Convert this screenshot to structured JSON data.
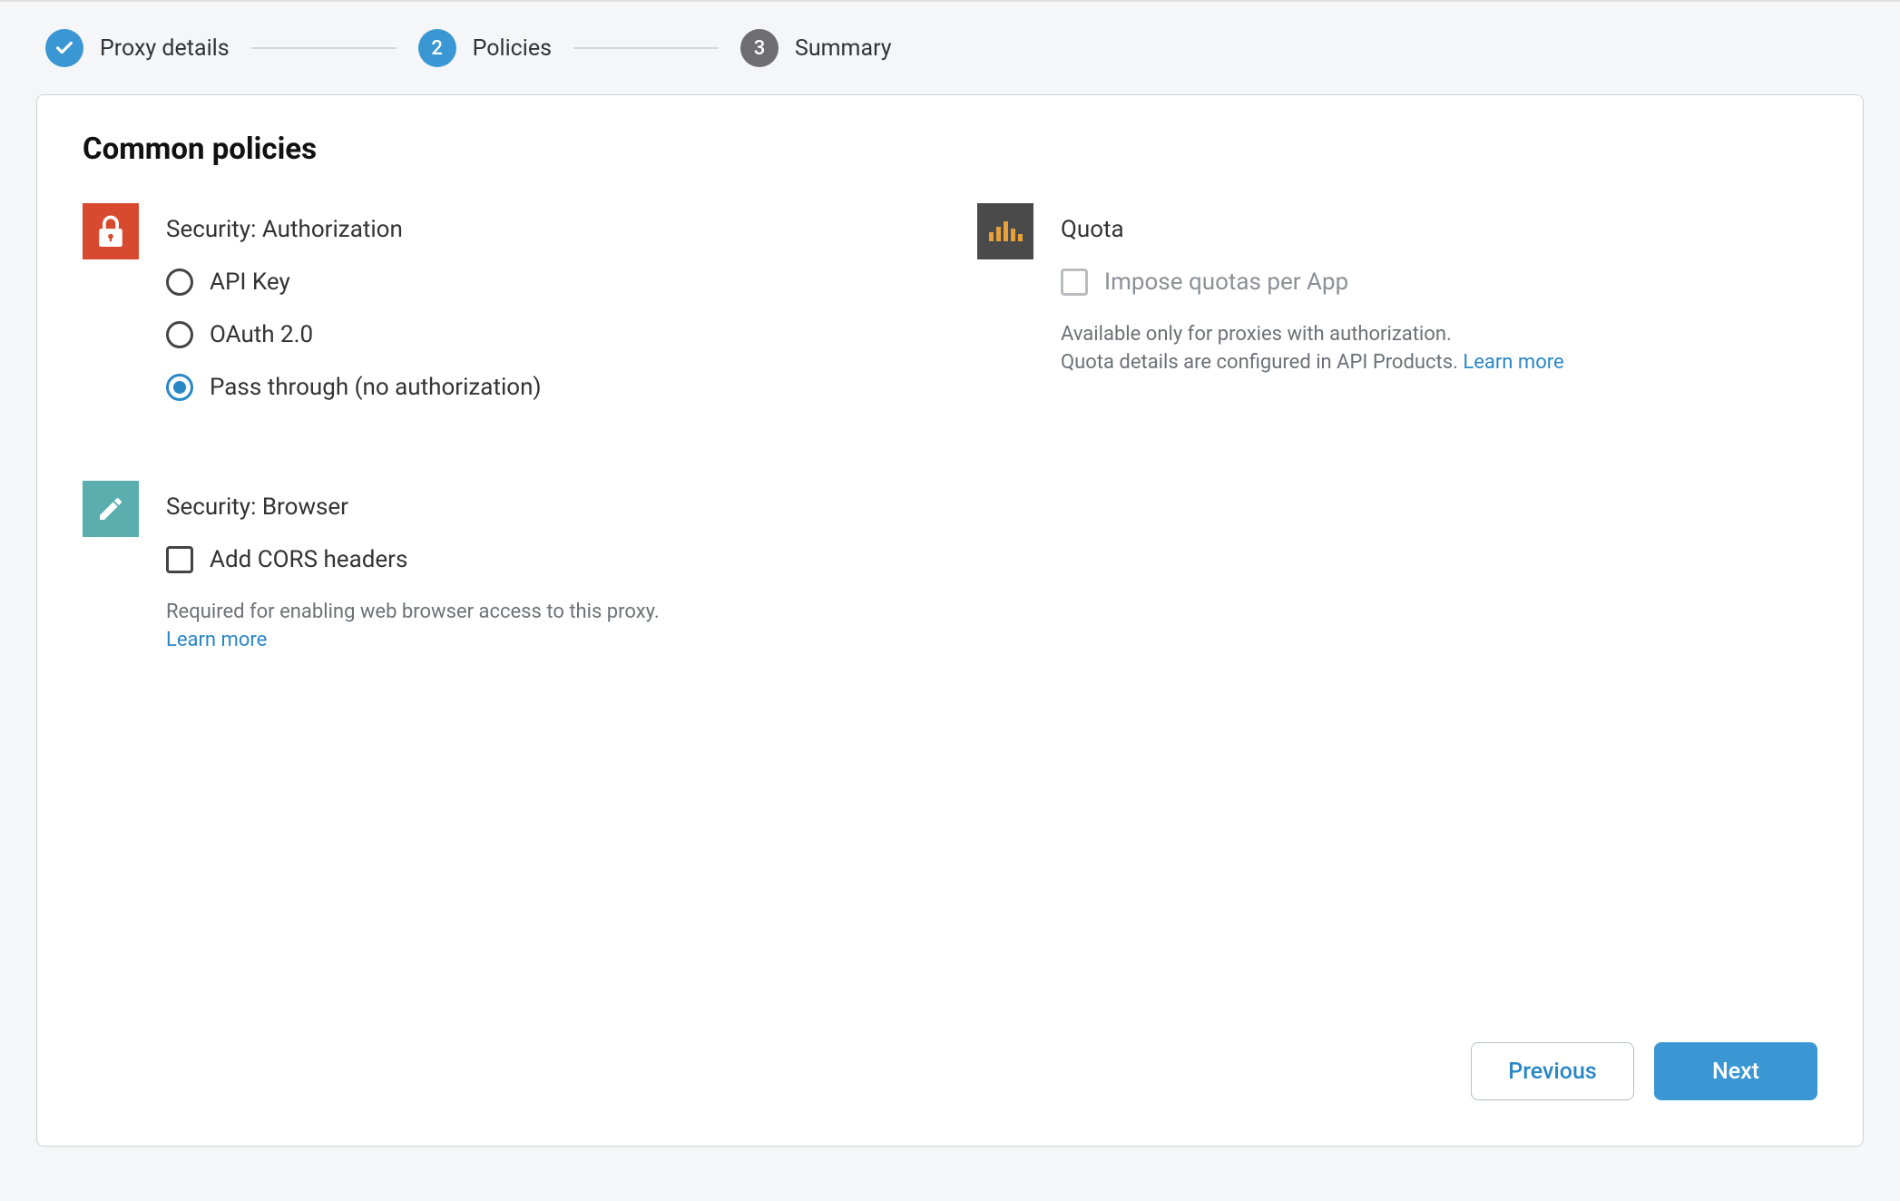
{
  "stepper": {
    "steps": [
      {
        "label": "Proxy details"
      },
      {
        "num": "2",
        "label": "Policies"
      },
      {
        "num": "3",
        "label": "Summary"
      }
    ]
  },
  "heading": "Common policies",
  "security_auth": {
    "title": "Security: Authorization",
    "options": [
      "API Key",
      "OAuth 2.0",
      "Pass through (no authorization)"
    ]
  },
  "security_browser": {
    "title": "Security: Browser",
    "checkbox_label": "Add CORS headers",
    "help_text": "Required for enabling web browser access to this proxy.",
    "help_link": "Learn more"
  },
  "quota": {
    "title": "Quota",
    "checkbox_label": "Impose quotas per App",
    "help_line1": "Available only for proxies with authorization.",
    "help_line2": "Quota details are configured in API Products.",
    "help_link": "Learn more"
  },
  "footer": {
    "previous": "Previous",
    "next": "Next"
  }
}
